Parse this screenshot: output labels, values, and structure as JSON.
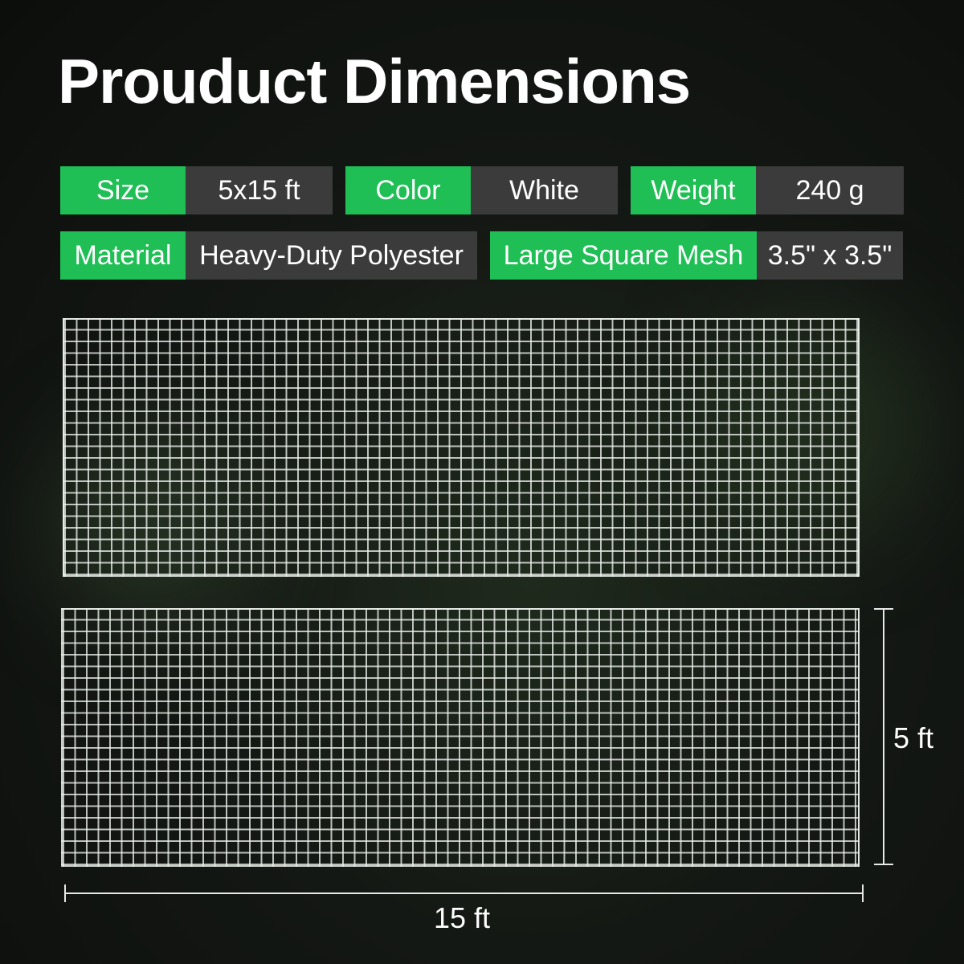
{
  "title": "Prouduct Dimensions",
  "accent_color": "#1fbf55",
  "value_bg_color": "#3a3b3a",
  "specs": {
    "size": {
      "label": "Size",
      "value": "5x15 ft"
    },
    "color": {
      "label": "Color",
      "value": "White"
    },
    "weight": {
      "label": "Weight",
      "value": "240 g"
    },
    "material": {
      "label": "Material",
      "value": "Heavy-Duty Polyester"
    },
    "mesh": {
      "label": "Large Square Mesh",
      "value": "3.5\" x 3.5\""
    }
  },
  "dimensions": {
    "height_label": "5 ft",
    "width_label": "15 ft"
  }
}
